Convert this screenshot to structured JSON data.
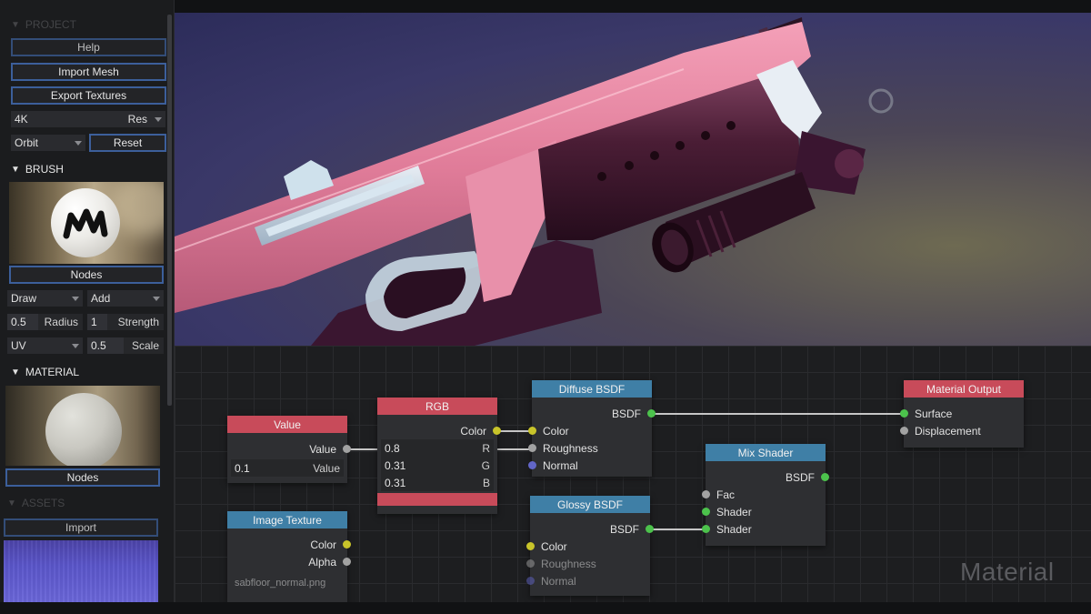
{
  "sidebar": {
    "project": {
      "heading": "PROJECT",
      "help_label": "Help",
      "import_mesh_label": "Import Mesh",
      "export_textures_label": "Export Textures",
      "resolution_value": "4K",
      "resolution_label": "Res",
      "camera_mode": "Orbit",
      "reset_label": "Reset"
    },
    "brush": {
      "heading": "BRUSH",
      "nodes_label": "Nodes",
      "tool": "Draw",
      "blend": "Add",
      "radius_value": "0.5",
      "radius_label": "Radius",
      "strength_value": "1",
      "strength_label": "Strength",
      "mapping": "UV",
      "scale_value": "0.5",
      "scale_label": "Scale"
    },
    "material": {
      "heading": "MATERIAL",
      "nodes_label": "Nodes"
    },
    "assets": {
      "heading": "ASSETS",
      "import_label": "Import"
    }
  },
  "nodes": {
    "value": {
      "title": "Value",
      "output": "Value",
      "field_value": "0.1",
      "field_label": "Value"
    },
    "rgb": {
      "title": "RGB",
      "output": "Color",
      "r_value": "0.8",
      "r_label": "R",
      "g_value": "0.31",
      "g_label": "G",
      "b_value": "0.31",
      "b_label": "B",
      "swatch_color": "#c84b5a"
    },
    "diffuse": {
      "title": "Diffuse BSDF",
      "output": "BSDF",
      "in_color": "Color",
      "in_roughness": "Roughness",
      "in_normal": "Normal"
    },
    "glossy": {
      "title": "Glossy BSDF",
      "output": "BSDF",
      "in_color": "Color",
      "in_roughness": "Roughness",
      "in_normal": "Normal"
    },
    "image_texture": {
      "title": "Image Texture",
      "out_color": "Color",
      "out_alpha": "Alpha",
      "file": "sabfloor_normal.png"
    },
    "mix_shader": {
      "title": "Mix Shader",
      "output": "BSDF",
      "in_fac": "Fac",
      "in_shader1": "Shader",
      "in_shader2": "Shader"
    },
    "material_output": {
      "title": "Material Output",
      "in_surface": "Surface",
      "in_displacement": "Displacement"
    }
  },
  "editor": {
    "watermark": "Material"
  },
  "colors": {
    "node_header_red": "#c84b5a",
    "node_header_blue": "#3f7fa6",
    "socket_color": "#c8c42a",
    "socket_float": "#a2a2a2",
    "socket_vector": "#6266c8",
    "socket_shader": "#4cc24c",
    "button_border": "#3c5f9b"
  }
}
